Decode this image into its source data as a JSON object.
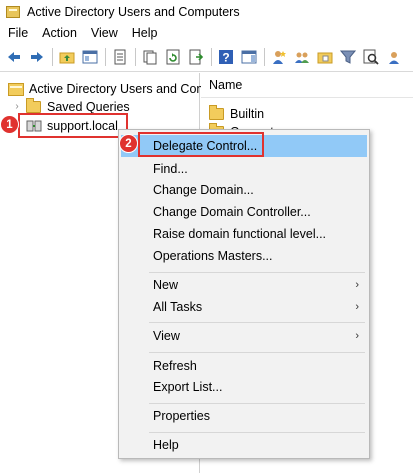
{
  "window": {
    "title": "Active Directory Users and Computers"
  },
  "menubar": {
    "items": [
      "File",
      "Action",
      "View",
      "Help"
    ]
  },
  "toolbar": {
    "icons": [
      "back-arrow-icon",
      "forward-arrow-icon",
      "up-folder-icon",
      "show-console-tree-icon",
      "properties-icon",
      "copy-icon",
      "refresh-icon",
      "export-list-icon",
      "help-icon",
      "show-action-pane-icon",
      "users-icon",
      "group-icon",
      "ou-icon",
      "filter-icon",
      "find-icon",
      "more-icon"
    ]
  },
  "tree": {
    "root": "Active Directory Users and Com",
    "saved_queries": "Saved Queries",
    "domain": "support.local"
  },
  "detail": {
    "header": "Name",
    "rows": [
      "Builtin",
      "Computers"
    ]
  },
  "context_menu": {
    "items": [
      {
        "label": "Delegate Control...",
        "selected": true
      },
      {
        "label": "Find..."
      },
      {
        "label": "Change Domain..."
      },
      {
        "label": "Change Domain Controller..."
      },
      {
        "label": "Raise domain functional level..."
      },
      {
        "label": "Operations Masters..."
      },
      {
        "label": "New",
        "submenu": true
      },
      {
        "label": "All Tasks",
        "submenu": true
      },
      {
        "label": "View",
        "submenu": true
      },
      {
        "label": "Refresh"
      },
      {
        "label": "Export List..."
      },
      {
        "label": "Properties"
      },
      {
        "label": "Help"
      }
    ],
    "submenu_arrow": "›"
  },
  "annotations": {
    "badge_1": "1",
    "badge_2": "2",
    "color": "#e0322f"
  },
  "colors": {
    "selection": "#91c9f7",
    "menu_bg": "#f2f2f2"
  }
}
